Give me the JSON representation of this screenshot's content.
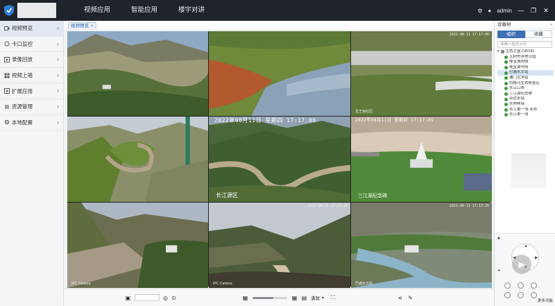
{
  "colors": {
    "topbar": "#1f242c",
    "accent": "#3b6fb6",
    "tree_online": "#3f9a3c"
  },
  "topbar": {
    "nav": [
      "视频应用",
      "智能应用",
      "楼宇对讲"
    ],
    "user": "admin",
    "icons": [
      "settings-icon",
      "user-icon",
      "minimize-icon",
      "restore-icon",
      "close-icon"
    ]
  },
  "sidebar": {
    "items": [
      {
        "label": "视频预览",
        "icon": "video-icon",
        "active": true
      },
      {
        "label": "卡口监控",
        "icon": "checkpoint-icon"
      },
      {
        "label": "录像回放",
        "icon": "playback-icon"
      },
      {
        "label": "视频上墙",
        "icon": "wall-icon"
      },
      {
        "label": "扩展应用",
        "icon": "extension-icon"
      },
      {
        "label": "资源管理",
        "icon": "resource-icon"
      },
      {
        "label": "本地配置",
        "icon": "config-icon"
      }
    ]
  },
  "tabs": [
    {
      "label": "视频预览",
      "closable": true
    }
  ],
  "cameras": [
    {
      "osd": "",
      "label": ""
    },
    {
      "osd": "",
      "label": ""
    },
    {
      "osd": "",
      "label": "龙王庙社区"
    },
    {
      "osd": "",
      "label": ""
    },
    {
      "osd": "2022年08月11日 星期四 17:17:06",
      "label": "长江源区"
    },
    {
      "osd": "2022年08月11日 星期四 17:17:05",
      "label": "三江源纪念碑"
    },
    {
      "osd": "",
      "label": "IPC Camera"
    },
    {
      "osd": "",
      "label": "IPC Camera"
    },
    {
      "osd": "",
      "label": "巴塘水文站"
    }
  ],
  "bottombar": {
    "layout_label": "满屏",
    "slider_value": 0.6,
    "icons": [
      "stop-all-icon",
      "record-icon",
      "snapshot-icon",
      "layout-icon",
      "fullscreen-icon",
      "share-icon",
      "tools-icon"
    ]
  },
  "rpanel": {
    "title": "设备树",
    "tabs": [
      "组织",
      "收藏"
    ],
    "search_placeholder": "请输入监控点名",
    "tree": {
      "root": "生态之窗 (18/18)",
      "items": [
        "玉树市滨地公园",
        "隆宝湖西侧",
        "隆宝湖中段",
        "巴塘水文站",
        "通门沱水站",
        "白格马生态修复区",
        "长江口岸",
        "三江源纪念碑",
        "杂达水站",
        "东仲林场",
        "长江第一湾-业务",
        "长江第一湾"
      ]
    },
    "selected_index": 3,
    "ptz": {
      "more": "更多功能"
    }
  }
}
